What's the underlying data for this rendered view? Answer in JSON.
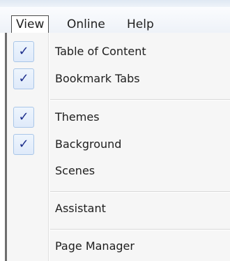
{
  "menubar": {
    "items": [
      {
        "label": "View"
      },
      {
        "label": "Online"
      },
      {
        "label": "Help"
      }
    ]
  },
  "view_menu": {
    "check_glyph": "✓",
    "items": [
      {
        "label": "Table of Content",
        "checked": true
      },
      {
        "label": "Bookmark Tabs",
        "checked": true
      },
      {
        "label": "Themes",
        "checked": true
      },
      {
        "label": "Background",
        "checked": true
      },
      {
        "label": "Scenes",
        "checked": false
      },
      {
        "label": "Assistant",
        "checked": false
      },
      {
        "label": "Page Manager",
        "checked": false
      }
    ]
  },
  "colors": {
    "check": "#1e2f8c",
    "check_box_border": "#a9c6e8"
  }
}
